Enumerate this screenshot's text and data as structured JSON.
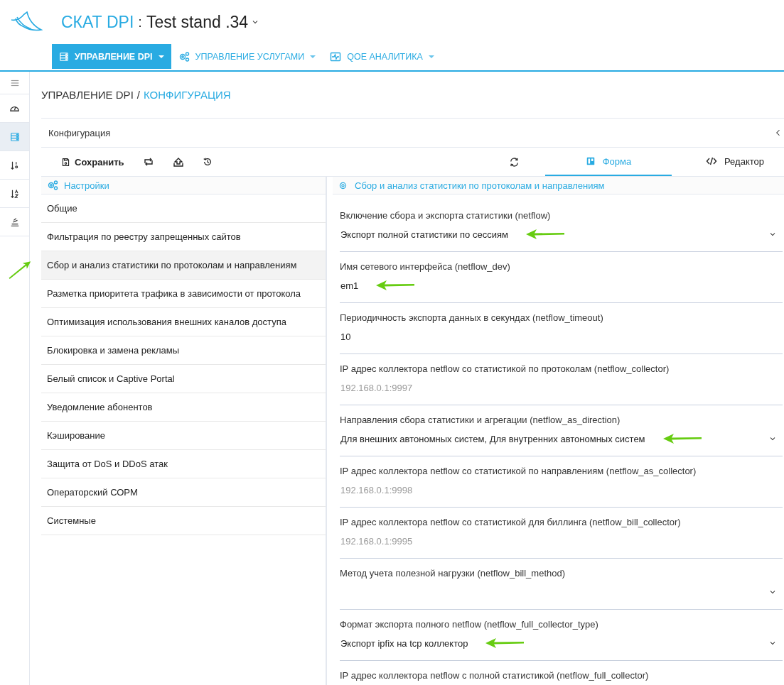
{
  "header": {
    "product": "СКАТ DPI",
    "separator": ":",
    "stand": "Test stand .34"
  },
  "nav": [
    {
      "label": "УПРАВЛЕНИЕ DPI",
      "selected": true
    },
    {
      "label": "УПРАВЛЕНИЕ УСЛУГАМИ",
      "selected": false
    },
    {
      "label": "QOE АНАЛИТИКА",
      "selected": false
    }
  ],
  "rail": [
    {
      "selected": false
    },
    {
      "selected": false
    },
    {
      "selected": true
    },
    {
      "selected": false
    },
    {
      "selected": false
    },
    {
      "selected": false
    }
  ],
  "breadcrumb": {
    "parent": "УПРАВЛЕНИЕ DPI",
    "divider": "/",
    "current": "КОНФИГУРАЦИЯ"
  },
  "panel": {
    "title": "Конфигурация"
  },
  "toolbar": {
    "save": "Сохранить"
  },
  "view_tabs": [
    {
      "label": "Форма",
      "selected": true
    },
    {
      "label": "Редактор",
      "selected": false
    }
  ],
  "sections": {
    "title": "Настройки",
    "items": [
      {
        "label": "Общие",
        "selected": false,
        "marked": false
      },
      {
        "label": "Фильтрация по реестру запрещенных сайтов",
        "selected": false,
        "marked": false
      },
      {
        "label": "Сбор и анализ статистики по протоколам и направлениям",
        "selected": true,
        "marked": true
      },
      {
        "label": "Разметка приоритета трафика в зависимости от протокола",
        "selected": false,
        "marked": false
      },
      {
        "label": "Оптимизация использования внешних каналов доступа",
        "selected": false,
        "marked": false
      },
      {
        "label": "Блокировка и замена рекламы",
        "selected": false,
        "marked": false
      },
      {
        "label": "Белый список и Captive Portal",
        "selected": false,
        "marked": false
      },
      {
        "label": "Уведомление абонентов",
        "selected": false,
        "marked": false
      },
      {
        "label": "Кэширование",
        "selected": false,
        "marked": false
      },
      {
        "label": "Защита от DoS и DDoS атак",
        "selected": false,
        "marked": false
      },
      {
        "label": "Операторский СОРМ",
        "selected": false,
        "marked": false
      },
      {
        "label": "Системные",
        "selected": false,
        "marked": false
      }
    ]
  },
  "form": {
    "title": "Сбор и анализ статистики по протоколам и направлениям",
    "fields": [
      {
        "kind": "select",
        "label": "Включение сбора и экспорта статистики (netflow)",
        "value": "Экспорт полной статистики по сессиям",
        "marked": true
      },
      {
        "kind": "text",
        "label": "Имя сетевого интерфейса (netflow_dev)",
        "value": "em1",
        "marked": true
      },
      {
        "kind": "text",
        "label": "Периодичность экспорта данных в секундах (netflow_timeout)",
        "value": "10",
        "marked": false
      },
      {
        "kind": "text",
        "label": "IP адрес коллектора netflow со статистикой по протоколам (netflow_collector)",
        "placeholder": "192.168.0.1:9997",
        "marked": false
      },
      {
        "kind": "select",
        "label": "Направления сбора статистики и агрегации (netflow_as_direction)",
        "value": "Для внешних автономных систем, Для внутренних автономных систем",
        "marked": true
      },
      {
        "kind": "text",
        "label": "IP адрес коллектора netflow со статистикой по направлениям (netflow_as_collector)",
        "placeholder": "192.168.0.1:9998",
        "marked": false
      },
      {
        "kind": "text",
        "label": "IP адрес коллектора netflow со статистикой для биллинга (netflow_bill_collector)",
        "placeholder": "192.168.0.1:9995",
        "marked": false
      },
      {
        "kind": "select",
        "label": "Метод учета полезной нагрузки (netflow_bill_method)",
        "marked": false
      },
      {
        "kind": "select",
        "label": "Формат экспорта полного netflow (netflow_full_collector_type)",
        "value": "Экспорт ipfix на tcp коллектор",
        "marked": true
      },
      {
        "kind": "text",
        "label": "IP адрес коллектора netflow с полной статистикой (netflow_full_collector)",
        "marked": false
      }
    ]
  }
}
